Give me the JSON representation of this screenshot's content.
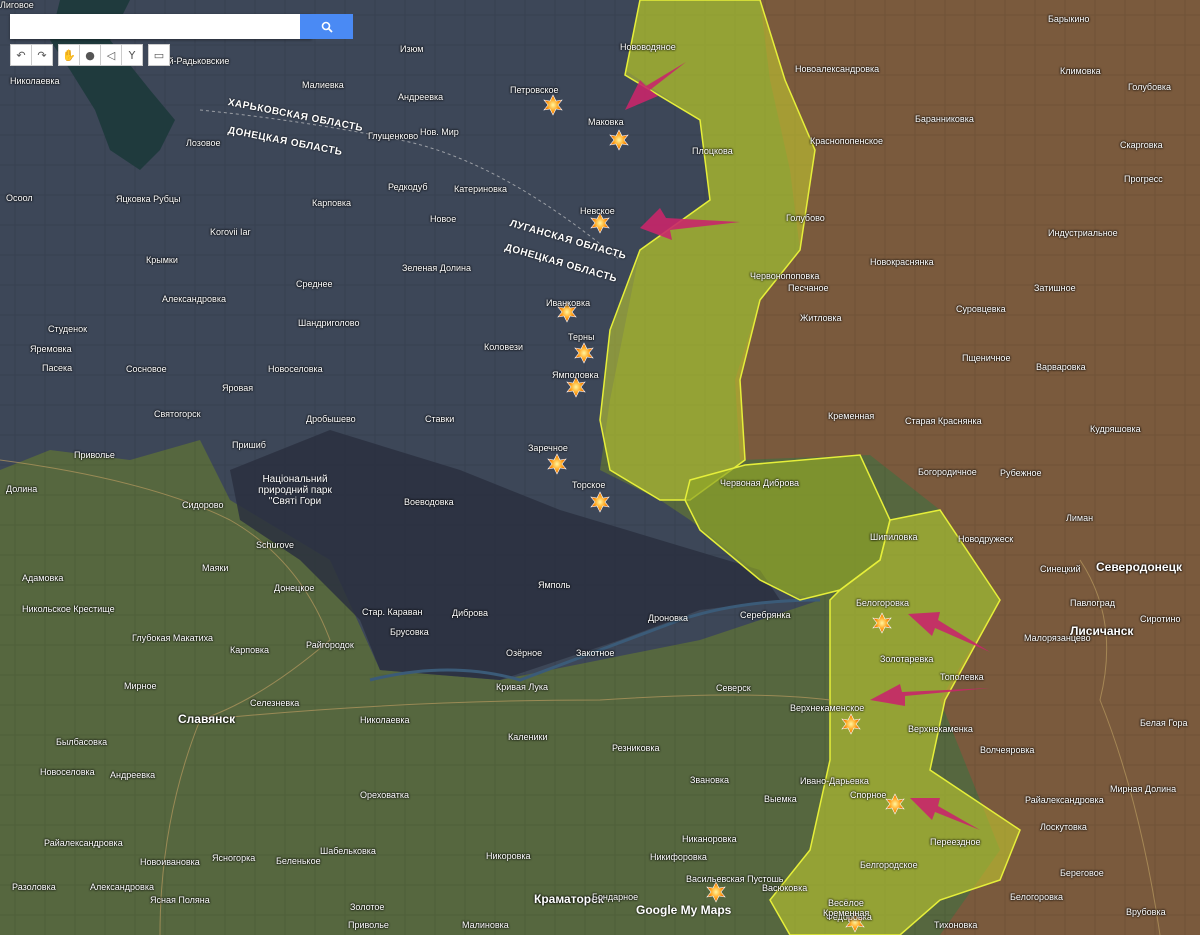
{
  "search": {
    "placeholder": "",
    "button_icon": "search-icon"
  },
  "tools": [
    {
      "name": "undo-icon",
      "glyph": "↶"
    },
    {
      "name": "redo-icon",
      "glyph": "↷"
    },
    {
      "name": "hand-icon",
      "glyph": "✋"
    },
    {
      "name": "marker-icon",
      "glyph": "●"
    },
    {
      "name": "polygon-icon",
      "glyph": "◁"
    },
    {
      "name": "route-icon",
      "glyph": "Y"
    },
    {
      "name": "ruler-icon",
      "glyph": "▭"
    }
  ],
  "regions": [
    {
      "text": "ХАРЬКОВСКАЯ ОБЛАСТЬ"
    },
    {
      "text": "ДОНЕЦКАЯ ОБЛАСТЬ"
    },
    {
      "text": "ЛУГАНСКАЯ ОБЛАСТЬ"
    },
    {
      "text": "ДОНЕЦКАЯ ОБЛАСТЬ"
    }
  ],
  "park_label": "Національний природний парк \"Святі Гори",
  "places": [
    "Изюм",
    "Нововодяное",
    "Барыкино",
    "Николаевка",
    "еский-Радьковские",
    "Малиевка",
    "Андреевка",
    "Петровское",
    "Новоалександровка",
    "Климовка",
    "Голубовка",
    "Маковка",
    "Баранниковка",
    "Лозовое",
    "Глущенково",
    "Нов. Мир",
    "Плоцкова",
    "Краснопопенское",
    "Скарговка",
    "Осоол",
    "Яцковка Рубцы",
    "Редкодуб",
    "Катериновка",
    "Прогресс",
    "Карповка",
    "Невское",
    "Голубово",
    "Индустриальное",
    "Новое",
    "Korovii Iar",
    "Крымки",
    "Червонопоповка",
    "Новокраснянка",
    "Зеленая Долина",
    "Среднее",
    "Песчаное",
    "Затишное",
    "Александровка",
    "Иванковка",
    "Житловка",
    "Суровцевка",
    "Студенок",
    "Шандриголово",
    "Терны",
    "Коловези",
    "Яремовка",
    "Пщеничное",
    "Пасека",
    "Сосновое",
    "Новоселовка",
    "Ямполовка",
    "Варваровка",
    "Яровая",
    "Кременная",
    "Старая Краснянка",
    "Кудряшовка",
    "Святогорск",
    "Дробышево",
    "Ставки",
    "Пришиб",
    "Заречное",
    "Богородичное",
    "Приволье",
    "Рубежное",
    "Червоная Диброва",
    "Долина",
    "Торское",
    "Сидорово",
    "Лиман",
    "Воеводовка",
    "Шипиловка",
    "Новодружеск",
    "Синецкий",
    "Северодонецк",
    "Адамовка",
    "Маяки",
    "Schurove",
    "Ямполь",
    "Белогоровка",
    "Павлоград",
    "Никольское Крестище",
    "Донецкое",
    "Стар. Караван",
    "Диброва",
    "Дроновка",
    "Серебрянка",
    "Лисичанск",
    "Сиротино",
    "Глубокая Макатиха",
    "Карповка",
    "Райгородок",
    "Брусовка",
    "Закотное",
    "Малорязанцево",
    "Мирное",
    "Озёрное",
    "Кривая Лука",
    "Северск",
    "Золотаревка",
    "Тополевка",
    "Славянск",
    "Селезневка",
    "Николаевка",
    "Верхнекаменское",
    "Верхнекаменка",
    "Былбасовка",
    "Каленики",
    "Резниковка",
    "Волчеяровка",
    "Белая Гора",
    "Новоселовка",
    "Андреевка",
    "Ореховатка",
    "Звановка",
    "Выемка",
    "Ивано-Дарьевка",
    "Мирная Долина",
    "Райалександровка",
    "Спорное",
    "Лоскутовка",
    "Райалександровка",
    "Шабельковка",
    "Никаноровка",
    "Переездное",
    "Никоровка",
    "Никифоровка",
    "Федоровка",
    "Белгородское",
    "Береговое",
    "Новоивановка",
    "Ясногорка",
    "Беленькое",
    "Васильевская Пустошь",
    "Разоловка",
    "Александровка",
    "Ясная Поляна",
    "Краматорск",
    "Бондарное",
    "Васюковка",
    "Весёлое",
    "Кременная",
    "Белогоровка",
    "Врубовка",
    "Золотое",
    "Малиновка",
    "Приволье",
    "Тихоновка",
    "Лиговое"
  ],
  "big_places": [
    "Славянск",
    "Краматорск",
    "Северодонецк",
    "Лисичанск"
  ],
  "watermark": "Google My Maps",
  "colors": {
    "occupied": "#c8d42e",
    "arrow": "#c8266a",
    "explosion": "#ff8c1a"
  }
}
